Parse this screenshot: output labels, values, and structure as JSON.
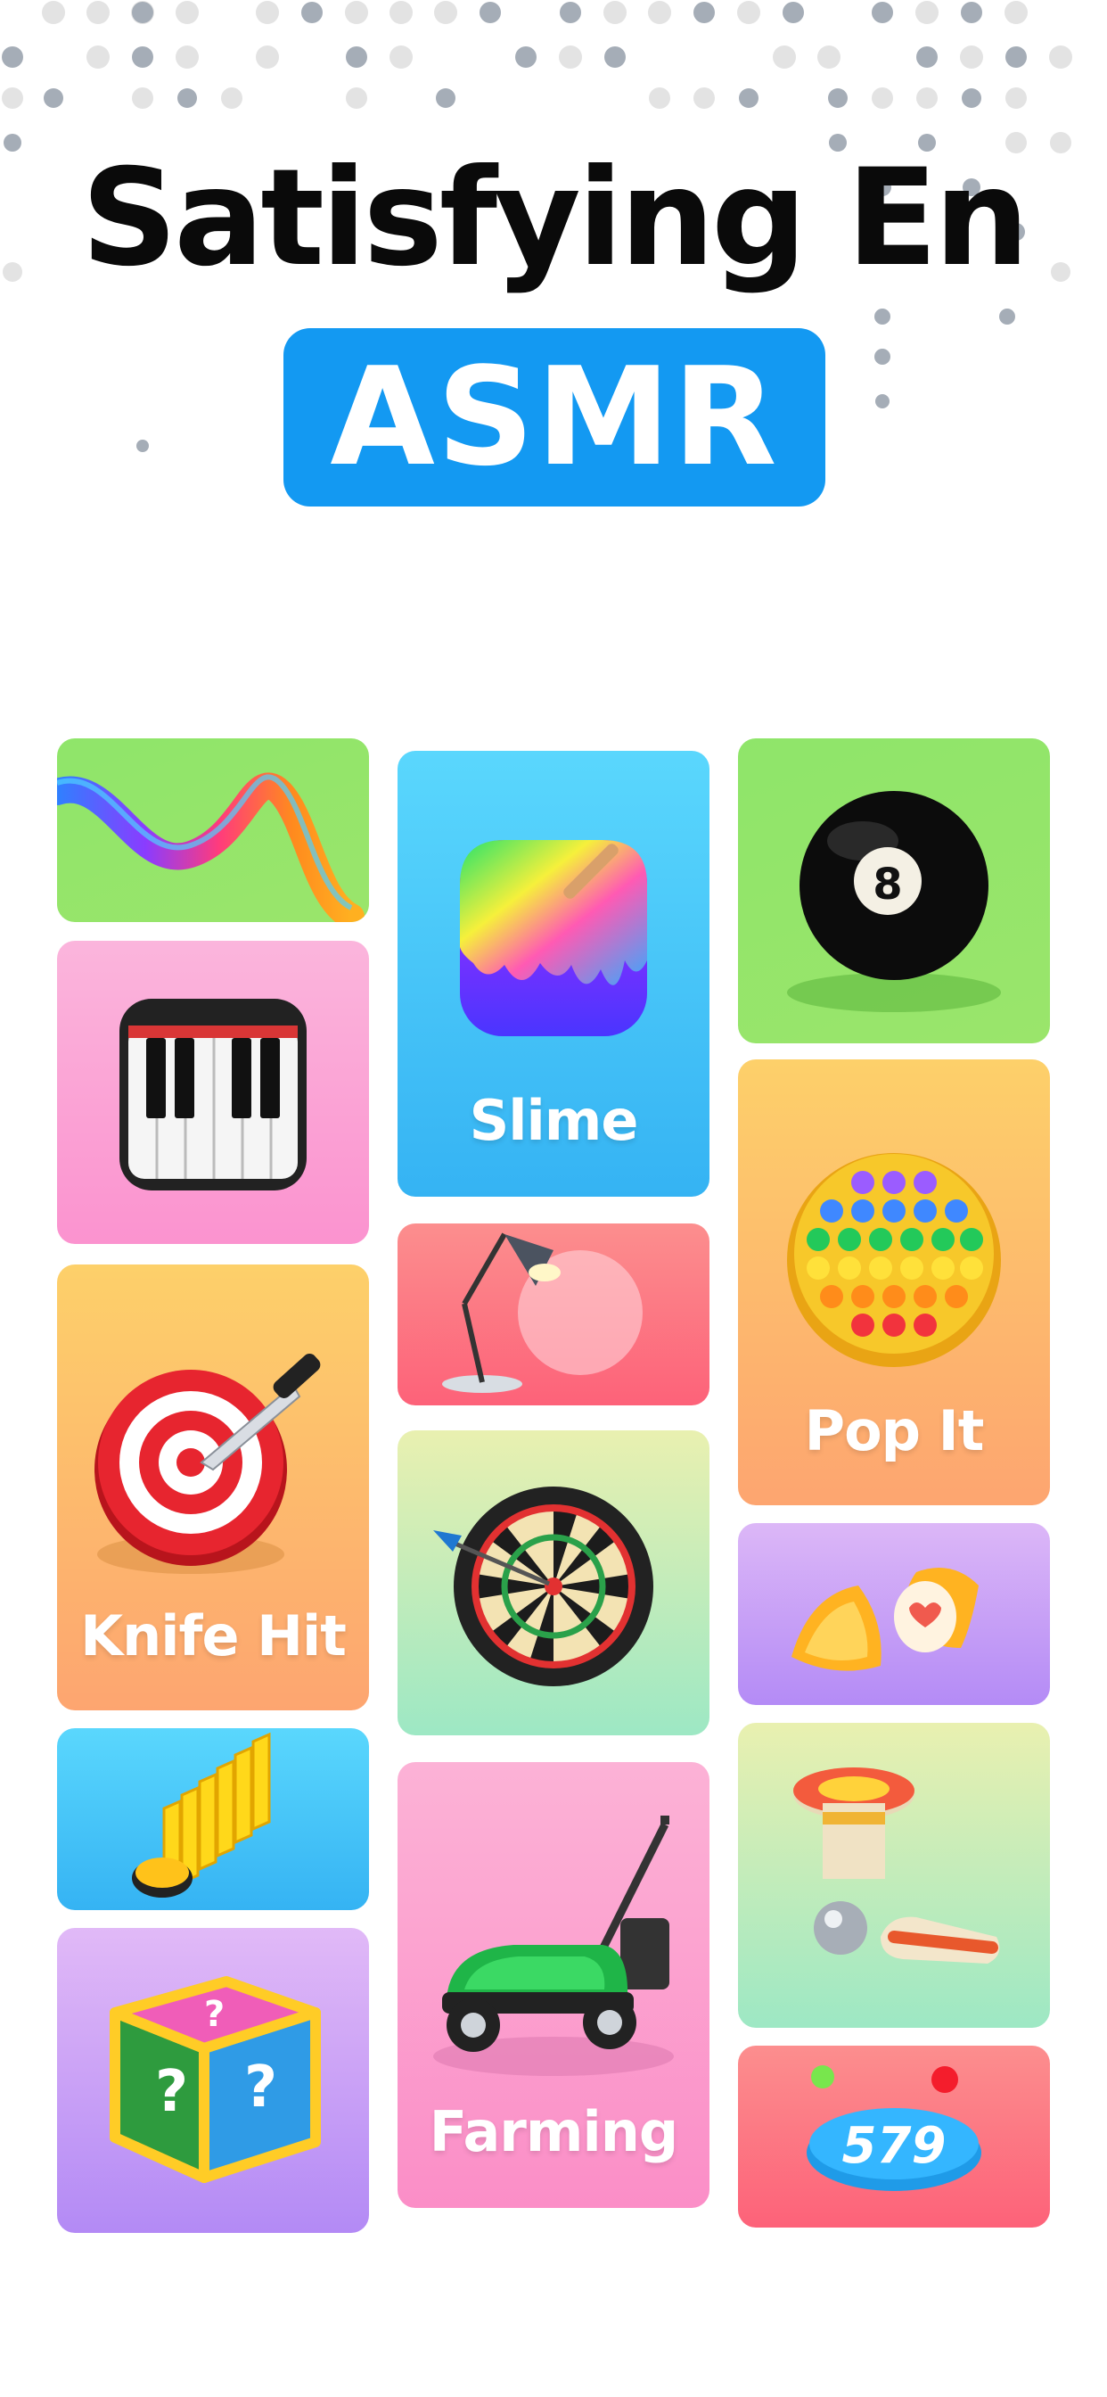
{
  "header": {
    "title": "Satisfying En",
    "badge": "ASMR"
  },
  "colors": {
    "badge_bg": "#1399f2",
    "title": "#0a0a0a",
    "label": "#ffffff"
  },
  "tiles": [
    {
      "icon": "ribbon-icon",
      "label": ""
    },
    {
      "icon": "piano-icon",
      "label": ""
    },
    {
      "icon": "knife-target-icon",
      "label": "Knife Hit"
    },
    {
      "icon": "domino-icon",
      "label": ""
    },
    {
      "icon": "mystery-box-icon",
      "label": ""
    },
    {
      "icon": "slime-icon",
      "label": "Slime"
    },
    {
      "icon": "desk-lamp-icon",
      "label": ""
    },
    {
      "icon": "dartboard-icon",
      "label": ""
    },
    {
      "icon": "lawn-mower-icon",
      "label": "Farming"
    },
    {
      "icon": "eight-ball-icon",
      "label": ""
    },
    {
      "icon": "pop-it-icon",
      "label": "Pop It"
    },
    {
      "icon": "egg-heart-icon",
      "label": ""
    },
    {
      "icon": "pinball-icon",
      "label": ""
    },
    {
      "icon": "score-ball-icon",
      "label": "579"
    }
  ]
}
